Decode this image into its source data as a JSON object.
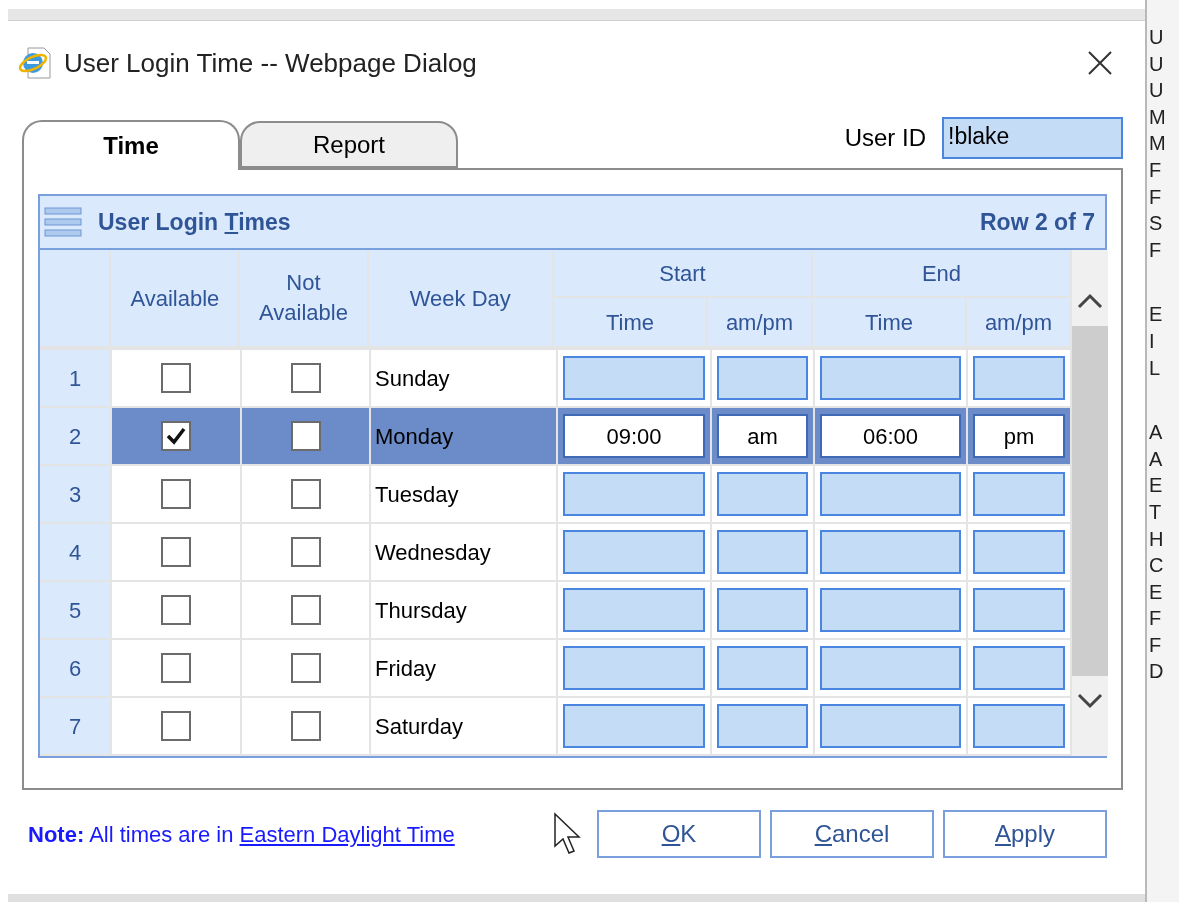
{
  "window": {
    "title": "User Login Time -- Webpage Dialog"
  },
  "tabs": [
    {
      "label": "Time",
      "selected": true
    },
    {
      "label": "Report",
      "selected": false
    }
  ],
  "user_id": {
    "label": "User ID",
    "value": "!blake"
  },
  "grid": {
    "title": {
      "before": "User Login ",
      "key": "T",
      "after": "imes"
    },
    "row_status": "Row 2 of 7",
    "headers": {
      "available": "Available",
      "not_available": "Not Available",
      "week_day": "Week Day"
    },
    "groups": [
      {
        "label": "Start",
        "columns": [
          "Time",
          "am/pm"
        ]
      },
      {
        "label": "End",
        "columns": [
          "Time",
          "am/pm"
        ]
      }
    ],
    "rows": [
      {
        "number": "1",
        "selected": false,
        "available": false,
        "not_available": false,
        "day": "Sunday"
      },
      {
        "number": "2",
        "selected": true,
        "available": true,
        "not_available": false,
        "day": "Monday",
        "start_time": "09:00",
        "start_ampm": "am",
        "end_time": "06:00",
        "end_ampm": "pm"
      },
      {
        "number": "3",
        "selected": false,
        "available": false,
        "not_available": false,
        "day": "Tuesday"
      },
      {
        "number": "4",
        "selected": false,
        "available": false,
        "not_available": false,
        "day": "Wednesday"
      },
      {
        "number": "5",
        "selected": false,
        "available": false,
        "not_available": false,
        "day": "Thursday"
      },
      {
        "number": "6",
        "selected": false,
        "available": false,
        "not_available": false,
        "day": "Friday"
      },
      {
        "number": "7",
        "selected": false,
        "available": false,
        "not_available": false,
        "day": "Saturday"
      }
    ]
  },
  "note": {
    "label": "Note:",
    "text": "All times are in",
    "link": "Eastern Daylight Time"
  },
  "buttons": [
    {
      "key": "O",
      "after": "K"
    },
    {
      "key": "C",
      "after": "ancel"
    },
    {
      "key": "A",
      "after": "pply"
    }
  ],
  "background_window": {
    "letters": [
      "U",
      "U",
      "U",
      "M",
      "M",
      "F",
      "F",
      "S",
      "F",
      "E",
      "I",
      "L",
      "A",
      "A",
      "E",
      "T",
      "H",
      "C",
      "E",
      "F",
      "F",
      "D"
    ]
  }
}
